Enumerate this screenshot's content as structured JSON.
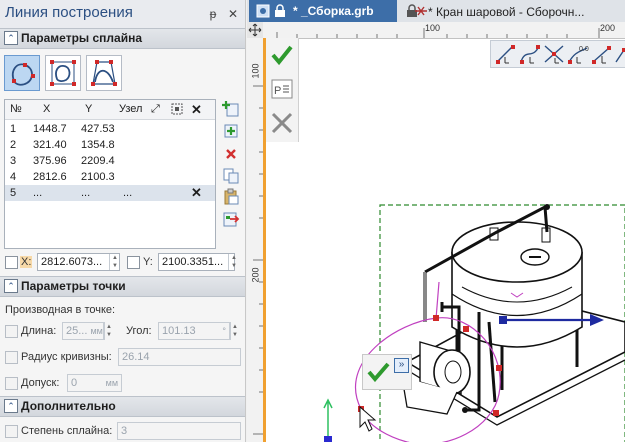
{
  "panel": {
    "title": "Линия построения",
    "pin_glyph": "ᵽ",
    "close_glyph": "✕",
    "sections": {
      "spline_params": "Параметры сплайна",
      "point_params": "Параметры точки",
      "additional": "Дополнительно"
    },
    "spline_modes": [
      "closed-spline-icon",
      "closed-curve-icon",
      "polyline-spline-icon"
    ],
    "table": {
      "headers": {
        "num": "№",
        "x": "X",
        "y": "Y",
        "node": "Узел"
      },
      "rows": [
        {
          "n": "1",
          "x": "1448.7",
          "y": "427.53"
        },
        {
          "n": "2",
          "x": "321.40",
          "y": "1354.8"
        },
        {
          "n": "3",
          "x": "375.96",
          "y": "2209.4"
        },
        {
          "n": "4",
          "x": "2812.6",
          "y": "2100.3"
        },
        {
          "n": "5",
          "x": "...",
          "y": "...",
          "node": "..."
        }
      ]
    },
    "coords": {
      "x_label": "X:",
      "x_value": "2812.6073...",
      "y_label": "Y:",
      "y_value": "2100.3351..."
    },
    "point": {
      "derivative_label": "Производная в точке:",
      "length_label": "Длина:",
      "length_value": "25...",
      "length_unit": "мм",
      "angle_label": "Угол:",
      "angle_value": "101.13",
      "angle_unit": "°",
      "curvature_label": "Радиус кривизны:",
      "curvature_value": "26.14",
      "tolerance_label": "Допуск:",
      "tolerance_value": "0",
      "tolerance_unit": "мм"
    },
    "additional": {
      "degree_label": "Степень сплайна:",
      "degree_value": "3"
    }
  },
  "tabs": [
    {
      "label": "* _Сборка.grb",
      "active": true
    },
    {
      "label": "* Кран шаровой - Сборочн...",
      "active": false
    }
  ],
  "ruler": {
    "top_labels": [
      "100",
      "200"
    ],
    "left_labels": [
      "100",
      "200"
    ]
  },
  "canvas_tools": {
    "left": [
      "ok-check-icon",
      "parameters-window-icon",
      "cancel-cross-icon"
    ],
    "top": [
      "spline-tool-1-icon",
      "spline-tool-2-icon",
      "spline-tool-3-icon",
      "spline-tool-4-icon",
      "spline-tool-5-icon"
    ],
    "confirm_more": "»"
  },
  "colors": {
    "accent": "#3d6ea8",
    "ok": "#2e9a2e",
    "cancel": "#d23030",
    "spline": "#c040c0",
    "node": "#d02828"
  }
}
